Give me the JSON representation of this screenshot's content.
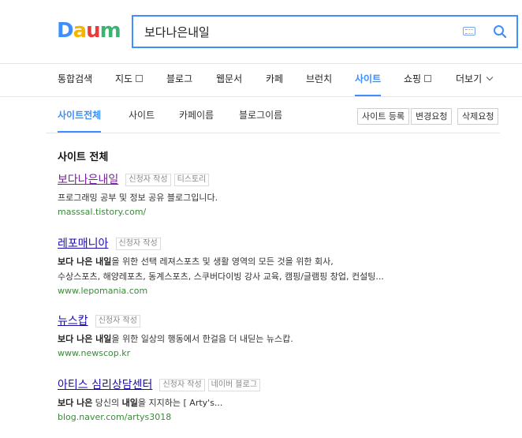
{
  "logo": {
    "letters": [
      "D",
      "a",
      "u",
      "m"
    ],
    "colors": [
      "#3c8ffd",
      "#f7b500",
      "#e63c3c",
      "#3cb371"
    ]
  },
  "search": {
    "value": "보다나은내일",
    "keyboard_icon": "keyboard-icon",
    "search_icon": "search-icon"
  },
  "nav": {
    "items": [
      {
        "label": "통합검색"
      },
      {
        "label": "지도"
      },
      {
        "label": "블로그"
      },
      {
        "label": "웹문서"
      },
      {
        "label": "카페"
      },
      {
        "label": "브런치"
      },
      {
        "label": "사이트"
      },
      {
        "label": "쇼핑"
      },
      {
        "label": "더보기"
      }
    ],
    "active": "사이트"
  },
  "subtabs": {
    "items": [
      {
        "label": "사이트전체"
      },
      {
        "label": "사이트"
      },
      {
        "label": "카페이름"
      },
      {
        "label": "블로그이름"
      }
    ]
  },
  "buttons": {
    "register": "사이트 등록",
    "change": "변경요청",
    "delete": "삭제요청"
  },
  "section_title": "사이트 전체",
  "results": [
    {
      "title": "보다나은내일",
      "tags": [
        "신청자 작성",
        "티스토리"
      ],
      "desc": [
        "프로그래밍 공부 및 정보 공유 블로그입니다."
      ],
      "url": "masssal.tistory.com/"
    },
    {
      "title": "레포매니아",
      "tags": [
        "신청자 작성"
      ],
      "desc_bold": "보다 나은 내일",
      "desc_rest": "을 위한 선택 레져스포츠 및 생활 영역의 모든 것을 위한 회사,",
      "desc2": "수상스포츠, 해양레포츠, 동계스포츠, 스쿠버다이빙 강사 교육, 캠핑/글램핑 창업, 컨설팅...",
      "url": "www.lepomania.com"
    },
    {
      "title": "뉴스캅",
      "tags": [
        "신청자 작성"
      ],
      "desc_bold": "보다 나은 내일",
      "desc_rest": "을 위한 일상의 행동에서 한걸음 더 내딛는 뉴스캅.",
      "url": "www.newscop.kr"
    },
    {
      "title": "아티스 심리상담센터",
      "tags": [
        "신청자 작성",
        "네이버 블로그"
      ],
      "desc_bold1": "보다 나은",
      "desc_mid": " 당신의 ",
      "desc_bold2": "내일",
      "desc_rest": "을 지지하는 [ Arty's...",
      "url": "blog.naver.com/artys3018"
    }
  ]
}
